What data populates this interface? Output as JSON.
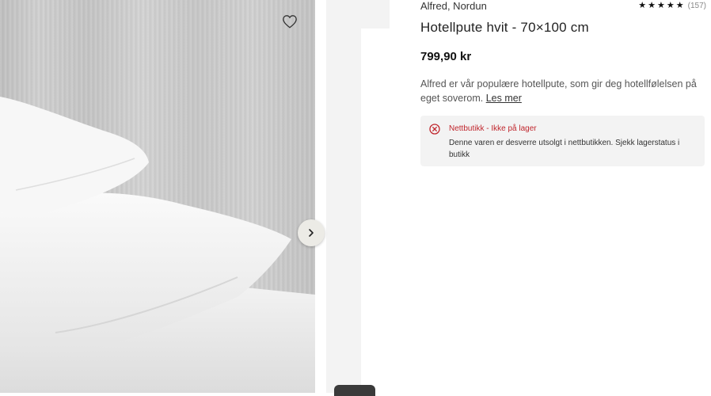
{
  "product": {
    "brand": "Alfred, Nordun",
    "title": "Hotellpute hvit - 70×100 cm",
    "price": "799,90 kr",
    "description": "Alfred er vår populære hotellpute, som gir deg hotellfølelsen på eget soverom.",
    "read_more": "Les mer",
    "rating": {
      "stars": 5,
      "count": "(157)"
    }
  },
  "stock": {
    "title": "Nettbutikk - Ikke på lager",
    "message": "Denne varen er desverre utsolgt i nettbutikken. Sjekk lagerstatus i butikk"
  },
  "icons": {
    "wishlist": "heart-icon",
    "next": "chevron-right-icon",
    "stock_status": "error-circle-x-icon"
  },
  "colors": {
    "error": "#c0262d",
    "notice_bg": "#f3f3f3"
  }
}
